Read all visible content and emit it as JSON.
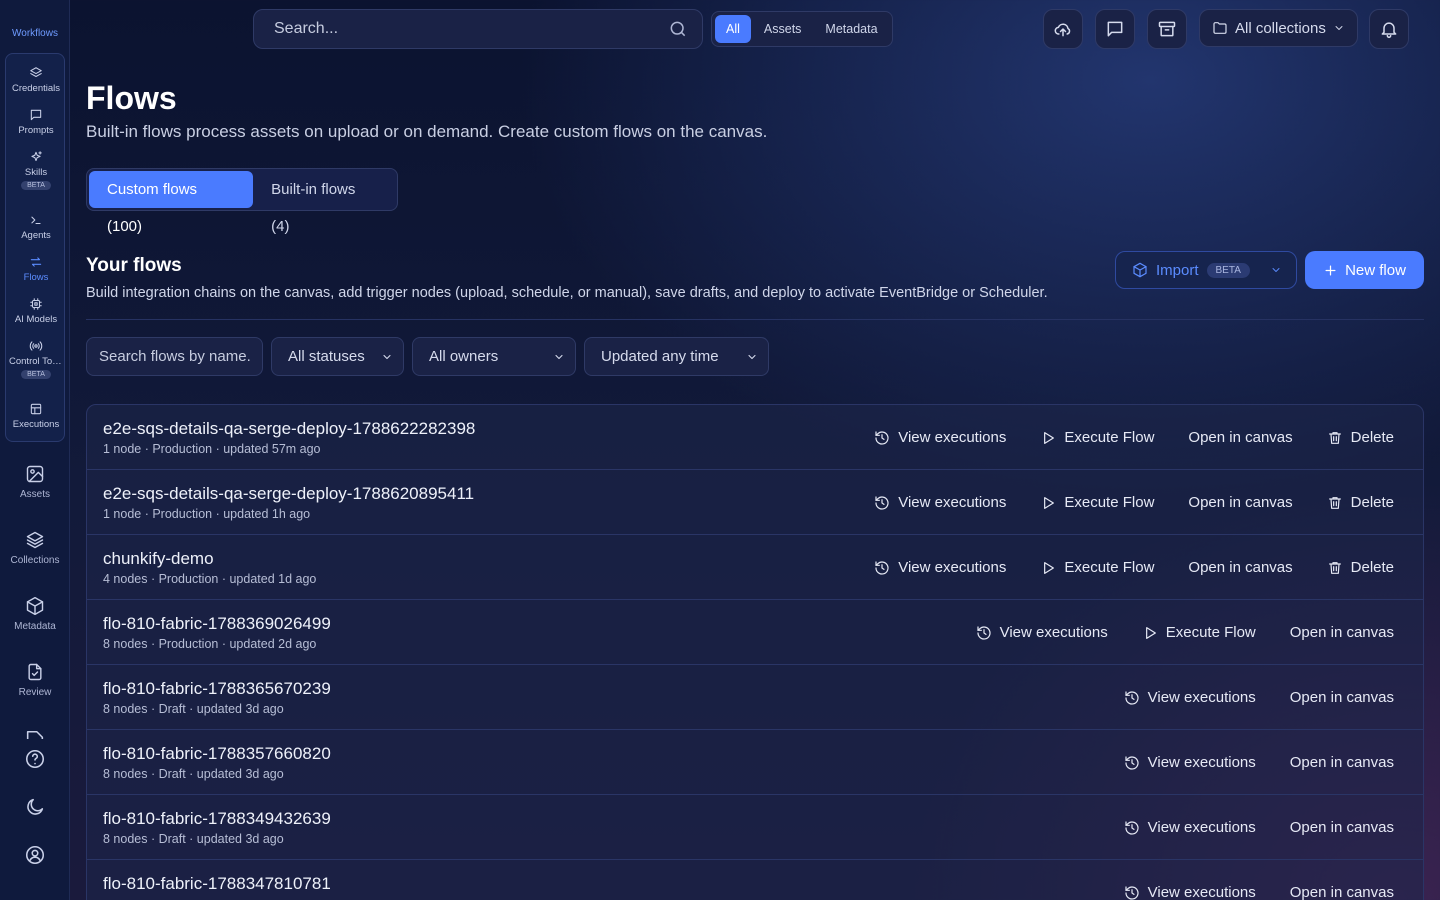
{
  "sidebar": {
    "title": "Workflows",
    "group_items": [
      {
        "label": "Credentials",
        "icon": "layers-icon"
      },
      {
        "label": "Prompts",
        "icon": "message-icon"
      },
      {
        "label": "Skills",
        "icon": "sparkles-icon",
        "badge": "BETA"
      },
      {
        "label": "Agents",
        "icon": "terminal-icon"
      },
      {
        "label": "Flows",
        "icon": "arrows-icon",
        "active": true
      },
      {
        "label": "AI Models",
        "icon": "cpu-icon"
      },
      {
        "label": "Control Tower",
        "icon": "broadcast-icon",
        "badge": "BETA"
      },
      {
        "label": "Executions",
        "icon": "table-icon"
      }
    ],
    "main_items": [
      {
        "label": "Assets",
        "icon": "image-icon"
      },
      {
        "label": "Collections",
        "icon": "stack-icon"
      },
      {
        "label": "Metadata",
        "icon": "cube-icon"
      },
      {
        "label": "Review",
        "icon": "clipboard-check-icon"
      }
    ],
    "bottom_icons": [
      "help-icon",
      "moon-icon",
      "user-circle-icon"
    ]
  },
  "topbar": {
    "search_placeholder": "Search...",
    "scope_options": [
      "All",
      "Assets",
      "Metadata"
    ],
    "scope_selected": "All",
    "collections_label": "All collections"
  },
  "header": {
    "title": "Flows",
    "subtitle": "Built-in flows process assets on upload or on demand. Create custom flows on the canvas.",
    "tabs": [
      {
        "label": "Custom flows (100)",
        "active": true
      },
      {
        "label": "Built-in flows (4)",
        "active": false
      }
    ]
  },
  "section": {
    "title": "Your flows",
    "subtitle": "Build integration chains on the canvas, add trigger nodes (upload, schedule, or manual), save drafts, and deploy to activate EventBridge or Scheduler.",
    "import_label": "Import",
    "import_badge": "BETA",
    "new_label": "New flow"
  },
  "filters": {
    "search_placeholder": "Search flows by name...",
    "status": "All statuses",
    "owner": "All owners",
    "time": "Updated any time"
  },
  "actions": {
    "view": "View executions",
    "execute": "Execute Flow",
    "open": "Open in canvas",
    "delete": "Delete"
  },
  "flows": [
    {
      "name": "e2e-sqs-details-qa-serge-deploy-1788622282398",
      "meta": "1 node · Production · updated 57m ago",
      "execute": true,
      "delete": true
    },
    {
      "name": "e2e-sqs-details-qa-serge-deploy-1788620895411",
      "meta": "1 node · Production · updated 1h ago",
      "execute": true,
      "delete": true
    },
    {
      "name": "chunkify-demo",
      "meta": "4 nodes · Production · updated 1d ago",
      "execute": true,
      "delete": true
    },
    {
      "name": "flo-810-fabric-1788369026499",
      "meta": "8 nodes · Production · updated 2d ago",
      "execute": true,
      "delete": false
    },
    {
      "name": "flo-810-fabric-1788365670239",
      "meta": "8 nodes · Draft · updated 3d ago",
      "execute": false,
      "delete": false
    },
    {
      "name": "flo-810-fabric-1788357660820",
      "meta": "8 nodes · Draft · updated 3d ago",
      "execute": false,
      "delete": false
    },
    {
      "name": "flo-810-fabric-1788349432639",
      "meta": "8 nodes · Draft · updated 3d ago",
      "execute": false,
      "delete": false
    },
    {
      "name": "flo-810-fabric-1788347810781",
      "meta": "",
      "execute": false,
      "delete": false
    }
  ]
}
